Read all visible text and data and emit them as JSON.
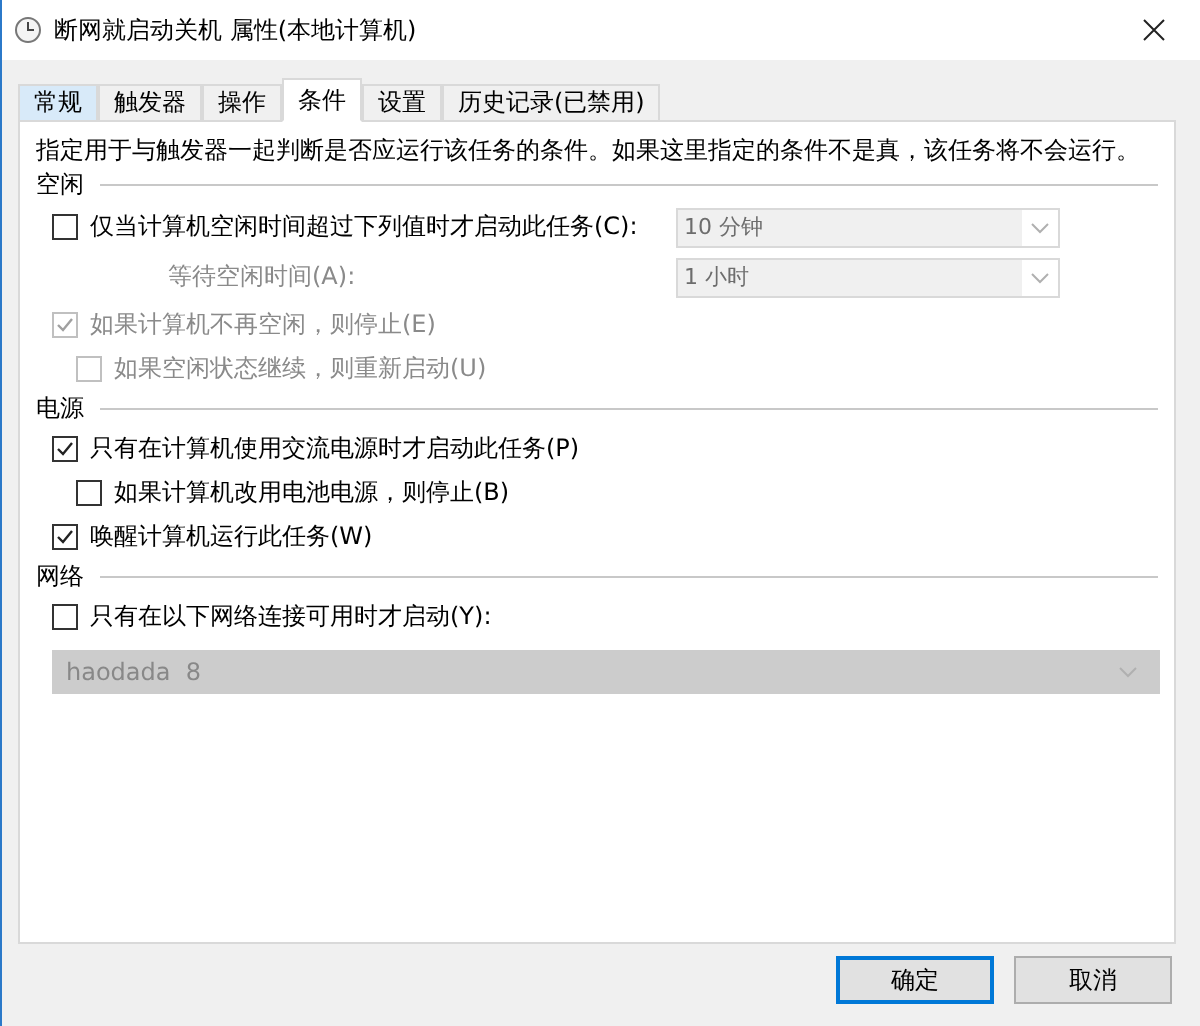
{
  "window": {
    "title": "断网就启动关机 属性(本地计算机)"
  },
  "tabs": [
    {
      "label": "常规",
      "selected": false,
      "hovered": true
    },
    {
      "label": "触发器",
      "selected": false,
      "hovered": false
    },
    {
      "label": "操作",
      "selected": false,
      "hovered": false
    },
    {
      "label": "条件",
      "selected": true,
      "hovered": false
    },
    {
      "label": "设置",
      "selected": false,
      "hovered": false
    },
    {
      "label": "历史记录(已禁用)",
      "selected": false,
      "hovered": false
    }
  ],
  "description": "指定用于与触发器一起判断是否应运行该任务的条件。如果这里指定的条件不是真，该任务将不会运行。",
  "sections": [
    {
      "heading": "空闲",
      "items": [
        {
          "kind": "checkbox_select",
          "label": "仅当计算机空闲时间超过下列值时才启动此任务(C):",
          "checked": false,
          "disabled": false,
          "value": "10 分钟",
          "select_disabled": true
        },
        {
          "kind": "label_select",
          "label": "等待空闲时间(A):",
          "disabled": true,
          "value": "1 小时",
          "select_disabled": true
        },
        {
          "kind": "checkbox",
          "label": "如果计算机不再空闲，则停止(E)",
          "checked": true,
          "disabled": true,
          "children": [
            {
              "kind": "checkbox",
              "label": "如果空闲状态继续，则重新启动(U)",
              "checked": false,
              "disabled": true
            }
          ]
        }
      ]
    },
    {
      "heading": "电源",
      "items": [
        {
          "kind": "checkbox",
          "label": "只有在计算机使用交流电源时才启动此任务(P)",
          "checked": true,
          "disabled": false,
          "children": [
            {
              "kind": "checkbox",
              "label": "如果计算机改用电池电源，则停止(B)",
              "checked": false,
              "disabled": false
            }
          ]
        },
        {
          "kind": "checkbox",
          "label": "唤醒计算机运行此任务(W)",
          "checked": true,
          "disabled": false
        }
      ]
    },
    {
      "heading": "网络",
      "items": [
        {
          "kind": "checkbox",
          "label": "只有在以下网络连接可用时才启动(Y):",
          "checked": false,
          "disabled": false
        },
        {
          "kind": "dropdown",
          "value": "haodada  8",
          "disabled": true
        }
      ]
    }
  ],
  "buttons": [
    {
      "label": "确定",
      "focused": true
    },
    {
      "label": "取消",
      "focused": false
    }
  ]
}
